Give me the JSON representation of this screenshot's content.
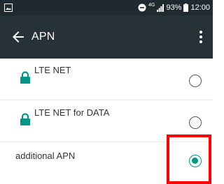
{
  "status_bar": {
    "network_type": "4G",
    "battery": "93%",
    "time": "12:00"
  },
  "toolbar": {
    "title": "APN",
    "back_icon": "arrow-left-icon",
    "menu_icon": "more-vertical-icon"
  },
  "apn_list": [
    {
      "name": "LTE NET",
      "locked": true,
      "selected": false
    },
    {
      "name": "LTE NET for DATA",
      "locked": true,
      "selected": false
    },
    {
      "name": "additional APN",
      "locked": false,
      "selected": true
    }
  ],
  "colors": {
    "toolbar": "#263238",
    "status_bar": "#1f2a30",
    "accent": "#009688",
    "lock": "#009688",
    "highlight": "#ff0000"
  }
}
